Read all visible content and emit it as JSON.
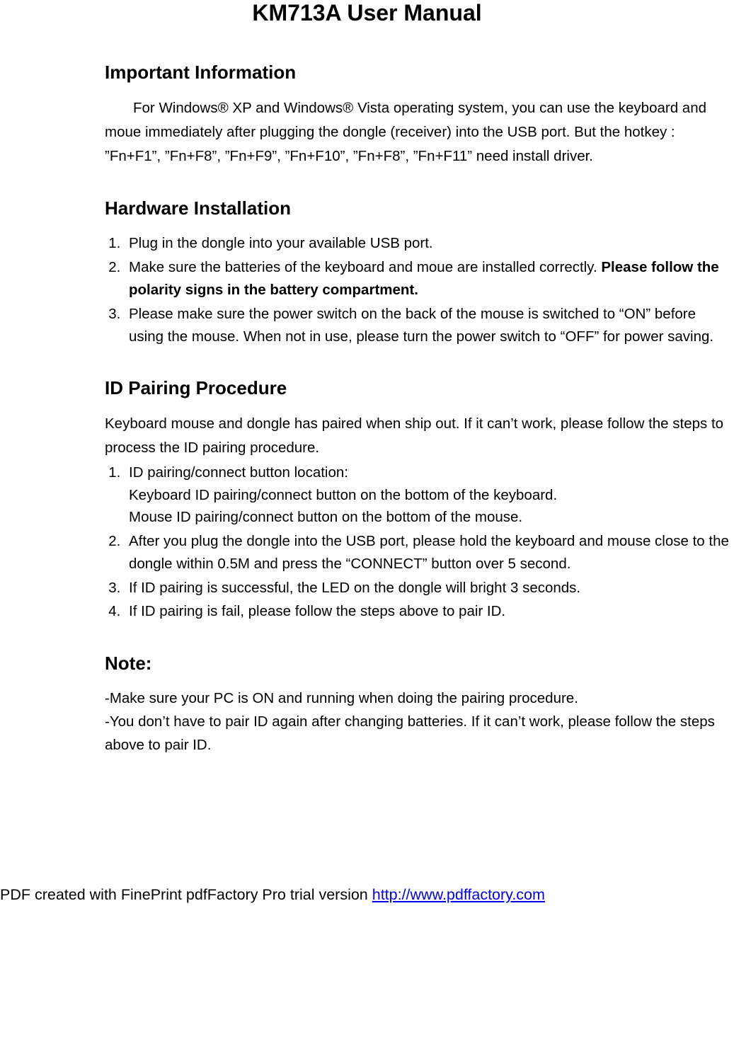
{
  "title": "KM713A User Manual",
  "sections": {
    "important": {
      "heading": "Important Information",
      "text": "For Windows® XP and Windows® Vista operating system, you can use the keyboard and moue immediately after plugging the dongle (receiver) into the USB port. But the hotkey : ”Fn+F1”, ”Fn+F8”, ”Fn+F9”, ”Fn+F10”, ”Fn+F8”, ”Fn+F11” need install driver."
    },
    "hardware": {
      "heading": "Hardware Installation",
      "item1": "Plug in the dongle into your available USB port.",
      "item2a": "Make sure the batteries of the keyboard and moue are installed correctly. ",
      "item2b": "Please follow the polarity signs in the battery compartment.",
      "item3": "Please make sure the power switch on the back of the mouse is switched to “ON” before using the mouse. When not in use, please turn the power switch to “OFF” for power saving."
    },
    "pairing": {
      "heading": "ID Pairing Procedure",
      "intro": "Keyboard mouse and dongle has paired when ship out. If it can’t work, please follow the steps to process the ID pairing procedure.",
      "item1a": "ID pairing/connect button location:",
      "item1b": "Keyboard ID pairing/connect button on the bottom of the keyboard.",
      "item1c": "Mouse ID pairing/connect button on the bottom of the mouse.",
      "item2": "After you plug the dongle into the USB port, please hold the keyboard and mouse close to the dongle within 0.5M and press the “CONNECT” button over 5 second.",
      "item3": "If ID pairing is successful, the LED on the dongle will bright 3 seconds.",
      "item4": "If ID pairing is fail, please follow the steps above to pair ID."
    },
    "note": {
      "heading": "Note:",
      "line1": "-Make sure your PC is ON and running when doing the pairing procedure.",
      "line2": "-You don’t have to pair ID again after changing batteries. If it can’t work, please follow the steps above to pair ID."
    }
  },
  "footer": {
    "text": "PDF created with FinePrint pdfFactory Pro trial version ",
    "link_text": "http://www.pdffactory.com",
    "link_href": "http://www.pdffactory.com"
  }
}
